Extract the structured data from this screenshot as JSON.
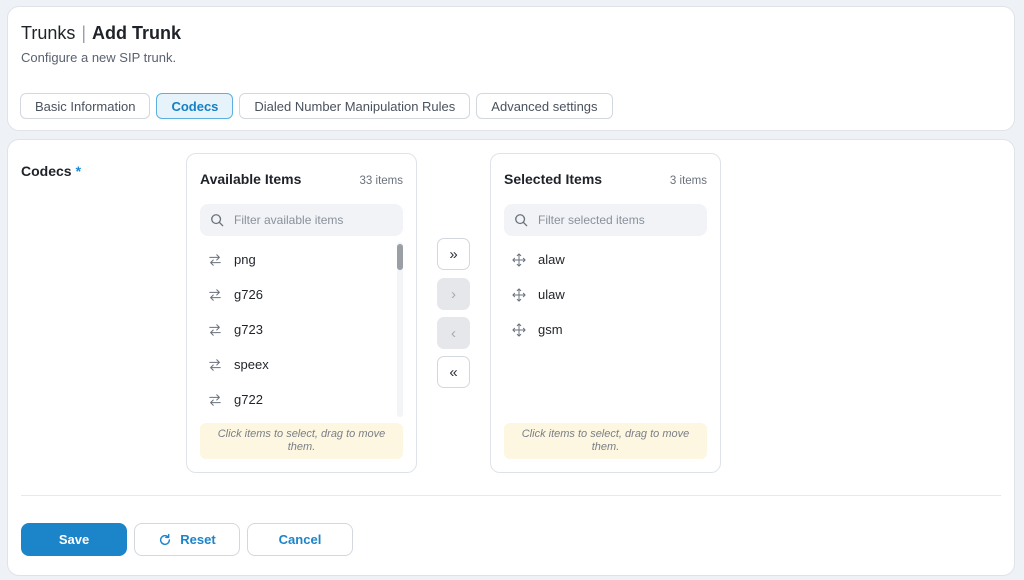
{
  "header": {
    "title": "Trunks",
    "separator": "|",
    "subtitle_title": "Add Trunk",
    "description": "Configure a new SIP trunk."
  },
  "tabs": [
    {
      "label": "Basic Information",
      "active": false
    },
    {
      "label": "Codecs",
      "active": true
    },
    {
      "label": "Dialed Number Manipulation Rules",
      "active": false
    },
    {
      "label": "Advanced settings",
      "active": false
    }
  ],
  "form": {
    "codecs_label": "Codecs",
    "required_marker": "*"
  },
  "available": {
    "title": "Available Items",
    "count": "33 items",
    "filter_placeholder": "Filter available items",
    "filter_value": "",
    "items": [
      "png",
      "g726",
      "g723",
      "speex",
      "g722"
    ],
    "hint": "Click items to select, drag to move them.",
    "scroll_position": 0.0
  },
  "selected": {
    "title": "Selected Items",
    "count": "3 items",
    "filter_placeholder": "Filter selected items",
    "filter_value": "",
    "items": [
      "alaw",
      "ulaw",
      "gsm"
    ],
    "hint": "Click items to select, drag to move them."
  },
  "transfer_buttons": {
    "move_all_right": "»",
    "move_right": "›",
    "move_left": "‹",
    "move_all_left": "«"
  },
  "actions": {
    "save": "Save",
    "reset": "Reset",
    "cancel": "Cancel"
  },
  "colors": {
    "accent": "#1c84c9",
    "active_tab_bg": "#e6f3fb",
    "hint_bg": "#fdf6e0",
    "required": "#1a8ad6"
  },
  "icons": {
    "filter": "search-icon",
    "available_item": "swap-arrows-icon",
    "selected_item": "drag-move-icon",
    "reset": "refresh-icon"
  }
}
